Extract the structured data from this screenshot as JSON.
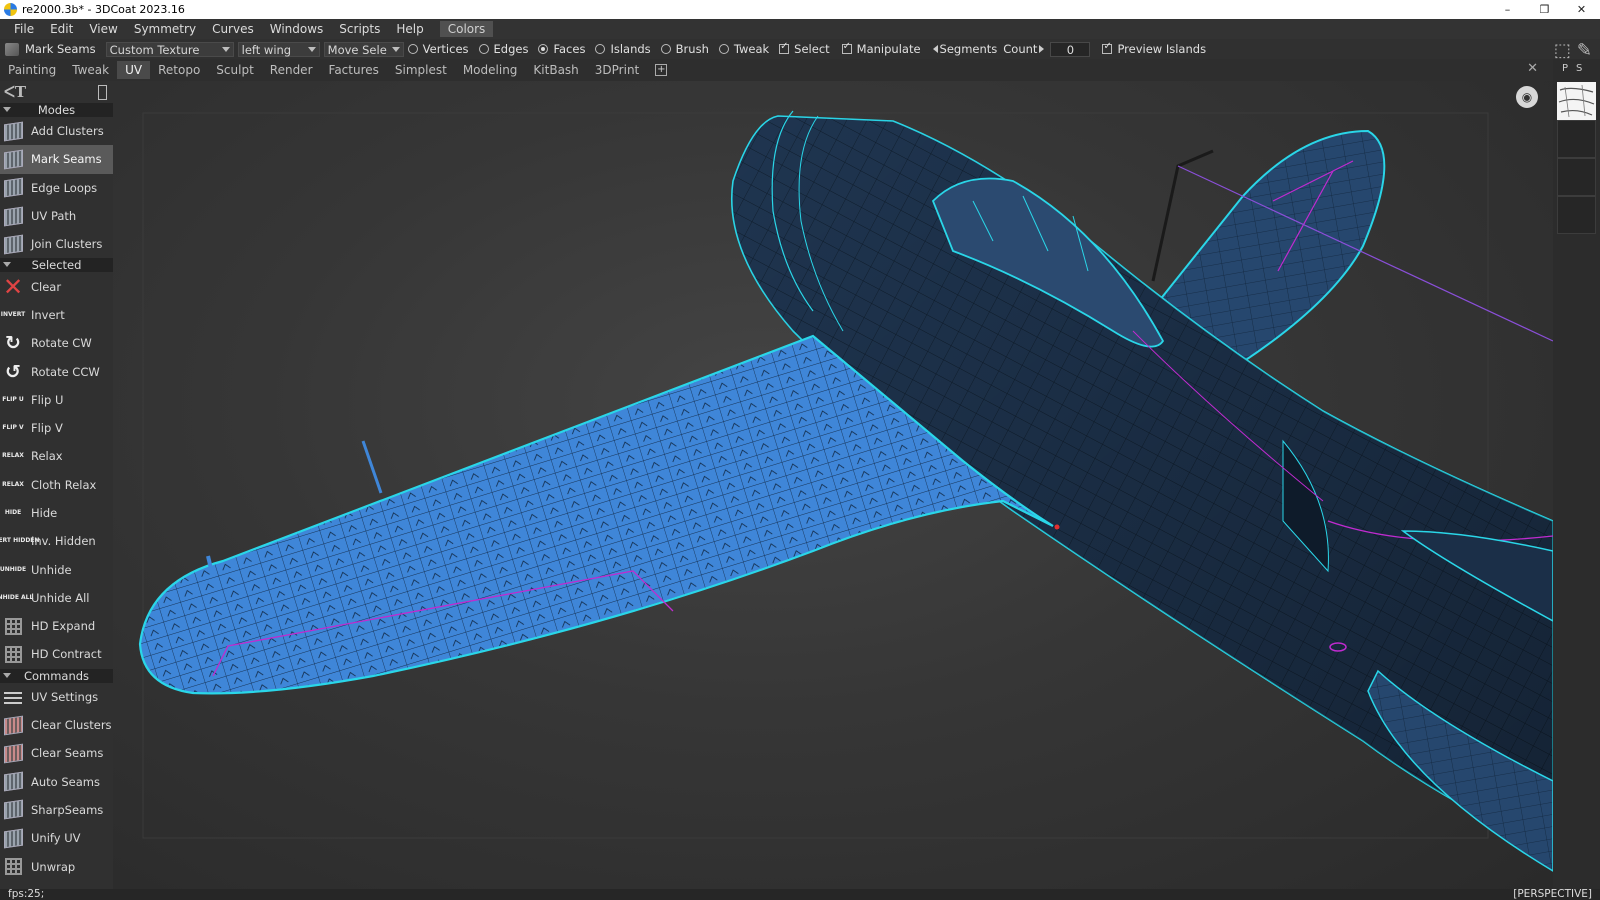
{
  "window": {
    "title": "re2000.3b* - 3DCoat 2023.16",
    "minimize": "–",
    "restore": "❐",
    "close": "✕"
  },
  "menu": [
    "File",
    "Edit",
    "View",
    "Symmetry",
    "Curves",
    "Windows",
    "Scripts",
    "Help",
    "Colors"
  ],
  "toolbar": {
    "tool_name": "Mark Seams",
    "texture_dropdown": "Custom Texture",
    "object_dropdown": "left wing",
    "move_dropdown": "Move Sele",
    "radios": [
      {
        "label": "Vertices",
        "on": false
      },
      {
        "label": "Edges",
        "on": false
      },
      {
        "label": "Faces",
        "on": true
      },
      {
        "label": "Islands",
        "on": false
      },
      {
        "label": "Brush",
        "on": false
      },
      {
        "label": "Tweak",
        "on": false
      }
    ],
    "select_label": "Select",
    "manipulate_label": "Manipulate",
    "segments_label": "Segments",
    "count_label": "Count",
    "count_value": "0",
    "preview_label": "Preview Islands"
  },
  "rooms": {
    "tabs": [
      "Painting",
      "Tweak",
      "UV",
      "Retopo",
      "Sculpt",
      "Render",
      "Factures",
      "Simplest",
      "Modeling",
      "KitBash",
      "3DPrint"
    ],
    "active": "UV",
    "add": "+",
    "close": "✕"
  },
  "leftpanel": {
    "sections": {
      "modes": "Modes",
      "selected": "Selected",
      "commands": "Commands"
    },
    "modes": [
      {
        "label": "Add  Clusters",
        "icon": "add-clusters-icon"
      },
      {
        "label": "Mark  Seams",
        "icon": "mark-seams-icon",
        "active": true
      },
      {
        "label": "Edge  Loops",
        "icon": "edge-loops-icon"
      },
      {
        "label": "UV  Path",
        "icon": "uv-path-icon"
      },
      {
        "label": "Join  Clusters",
        "icon": "join-clusters-icon"
      }
    ],
    "selected": [
      {
        "label": "Clear",
        "icon": "clear-icon"
      },
      {
        "label": "Invert",
        "icon": "invert-icon",
        "icon_text": "INVERT"
      },
      {
        "label": "Rotate  CW",
        "icon": "rotate-cw-icon"
      },
      {
        "label": "Rotate  CCW",
        "icon": "rotate-ccw-icon"
      },
      {
        "label": "Flip  U",
        "icon": "flip-u-icon",
        "icon_text": "FLIP U"
      },
      {
        "label": "Flip  V",
        "icon": "flip-v-icon",
        "icon_text": "FLIP V"
      },
      {
        "label": "Relax",
        "icon": "relax-icon",
        "icon_text": "RELAX"
      },
      {
        "label": "Cloth  Relax",
        "icon": "cloth-relax-icon",
        "icon_text": "RELAX"
      },
      {
        "label": "Hide",
        "icon": "hide-icon",
        "icon_text": "HIDE"
      },
      {
        "label": "Inv.  Hidden",
        "icon": "inv-hidden-icon",
        "icon_text": "INVERT HIDDEN"
      },
      {
        "label": "Unhide",
        "icon": "unhide-icon",
        "icon_text": "UNHIDE"
      },
      {
        "label": "Unhide  All",
        "icon": "unhide-all-icon",
        "icon_text": "UNHIDE ALL"
      },
      {
        "label": "HD  Expand",
        "icon": "hd-expand-icon"
      },
      {
        "label": "HD  Contract",
        "icon": "hd-contract-icon"
      }
    ],
    "commands": [
      {
        "label": "UV  Settings",
        "icon": "uv-settings-icon"
      },
      {
        "label": "Clear  Clusters",
        "icon": "clear-clusters-icon"
      },
      {
        "label": "Clear  Seams",
        "icon": "clear-seams-icon"
      },
      {
        "label": "Auto  Seams",
        "icon": "auto-seams-icon"
      },
      {
        "label": "SharpSeams",
        "icon": "sharp-seams-icon"
      },
      {
        "label": "Unify  UV",
        "icon": "unify-uv-icon"
      },
      {
        "label": "Unwrap",
        "icon": "unwrap-icon"
      }
    ]
  },
  "rightstrip": {
    "tab_p": "P",
    "tab_s": "S"
  },
  "status": {
    "fps": "fps:25;",
    "view_mode": "[PERSPECTIVE]"
  },
  "colors": {
    "wing_blue": "#3f86d8",
    "fuselage_navy": "#1f3550",
    "seam_cyan": "#2ad6e8",
    "seam_magenta": "#c02bd0"
  }
}
